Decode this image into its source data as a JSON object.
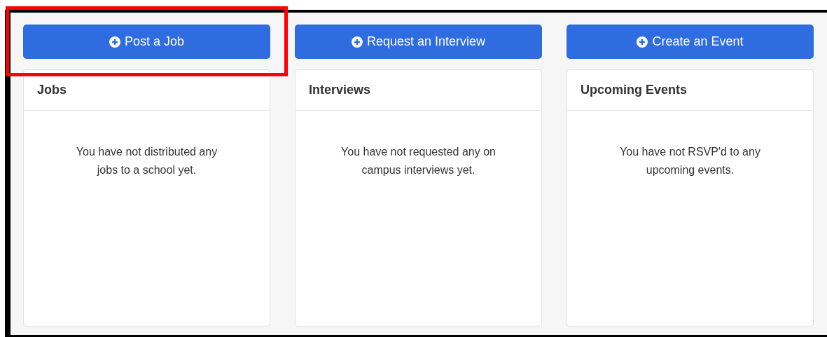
{
  "columns": [
    {
      "button": "Post a Job",
      "title": "Jobs",
      "message": "You have not distributed any jobs to a school yet.",
      "highlighted": true
    },
    {
      "button": "Request an Interview",
      "title": "Interviews",
      "message": "You have not requested any on campus interviews yet.",
      "highlighted": false
    },
    {
      "button": "Create an Event",
      "title": "Upcoming Events",
      "message": "You have not RSVP'd to any upcoming events.",
      "highlighted": false
    }
  ]
}
